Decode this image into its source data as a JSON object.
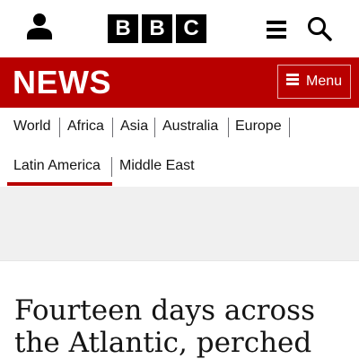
{
  "header": {
    "logo_letters": [
      "B",
      "B",
      "C"
    ],
    "icons": {
      "account": "account-icon",
      "more": "more-menu-icon",
      "search": "search-icon"
    }
  },
  "newsbar": {
    "logo_text": "NEWS",
    "menu_label": "Menu",
    "brand_color": "#b80000"
  },
  "nav": {
    "items": [
      {
        "label": "World"
      },
      {
        "label": "Africa"
      },
      {
        "label": "Asia"
      },
      {
        "label": "Australia"
      },
      {
        "label": "Europe"
      },
      {
        "label": "Latin America",
        "active": true
      },
      {
        "label": "Middle East"
      }
    ]
  },
  "article": {
    "headline": "Fourteen days across the Atlantic, perched"
  }
}
